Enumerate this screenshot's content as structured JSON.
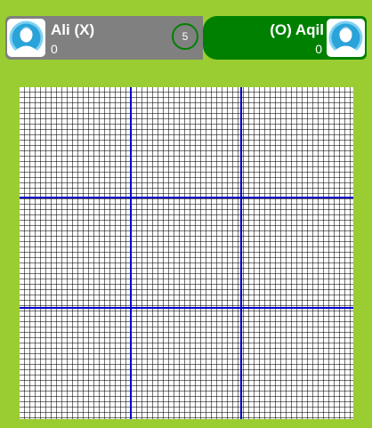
{
  "players": {
    "x": {
      "name": "Ali (X)",
      "score": "0",
      "avatar_icon": "user-avatar-icon"
    },
    "o": {
      "name": "(O) Aqil",
      "score": "0",
      "avatar_icon": "user-avatar-icon"
    }
  },
  "timer": "5",
  "board": {
    "cells": [
      "",
      "",
      "",
      "",
      "",
      "",
      "",
      "",
      ""
    ]
  },
  "colors": {
    "background": "#9acd32",
    "player_x_bar": "#808080",
    "player_o_bar": "#008000",
    "grid_lines": "#0000cc"
  }
}
